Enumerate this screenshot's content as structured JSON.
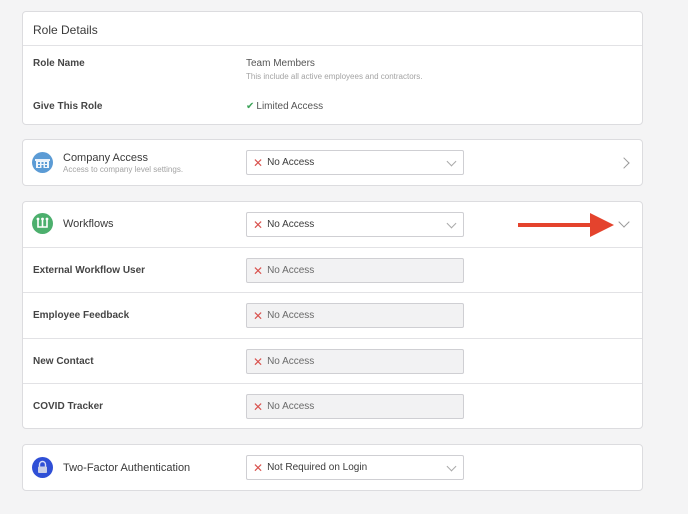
{
  "role_details": {
    "header": "Role Details",
    "role_name_label": "Role Name",
    "role_name_value": "Team Members",
    "role_name_desc": "This include all active employees and contractors.",
    "give_role_label": "Give This Role",
    "give_role_value": "Limited Access"
  },
  "company_access": {
    "title": "Company Access",
    "subtitle": "Access to company level settings.",
    "select_value": "No Access"
  },
  "workflows": {
    "title": "Workflows",
    "select_value": "No Access",
    "rows": [
      {
        "label": "External Workflow User",
        "value": "No Access"
      },
      {
        "label": "Employee Feedback",
        "value": "No Access"
      },
      {
        "label": "New Contact",
        "value": "No Access"
      },
      {
        "label": "COVID Tracker",
        "value": "No Access"
      }
    ]
  },
  "two_factor": {
    "title": "Two-Factor Authentication",
    "select_value": "Not Required on Login"
  },
  "colors": {
    "accent_arrow": "#e4432d",
    "check_green": "#3fa45b",
    "x_red": "#d9534f",
    "company_icon": "#5b9bd5",
    "workflows_icon": "#4caf6d",
    "twofactor_icon": "#2f4fd6"
  },
  "icons": {
    "company": "building-icon",
    "workflows": "workflow-icon",
    "twofactor": "lock-icon",
    "x": "x-icon",
    "check": "check-icon"
  }
}
